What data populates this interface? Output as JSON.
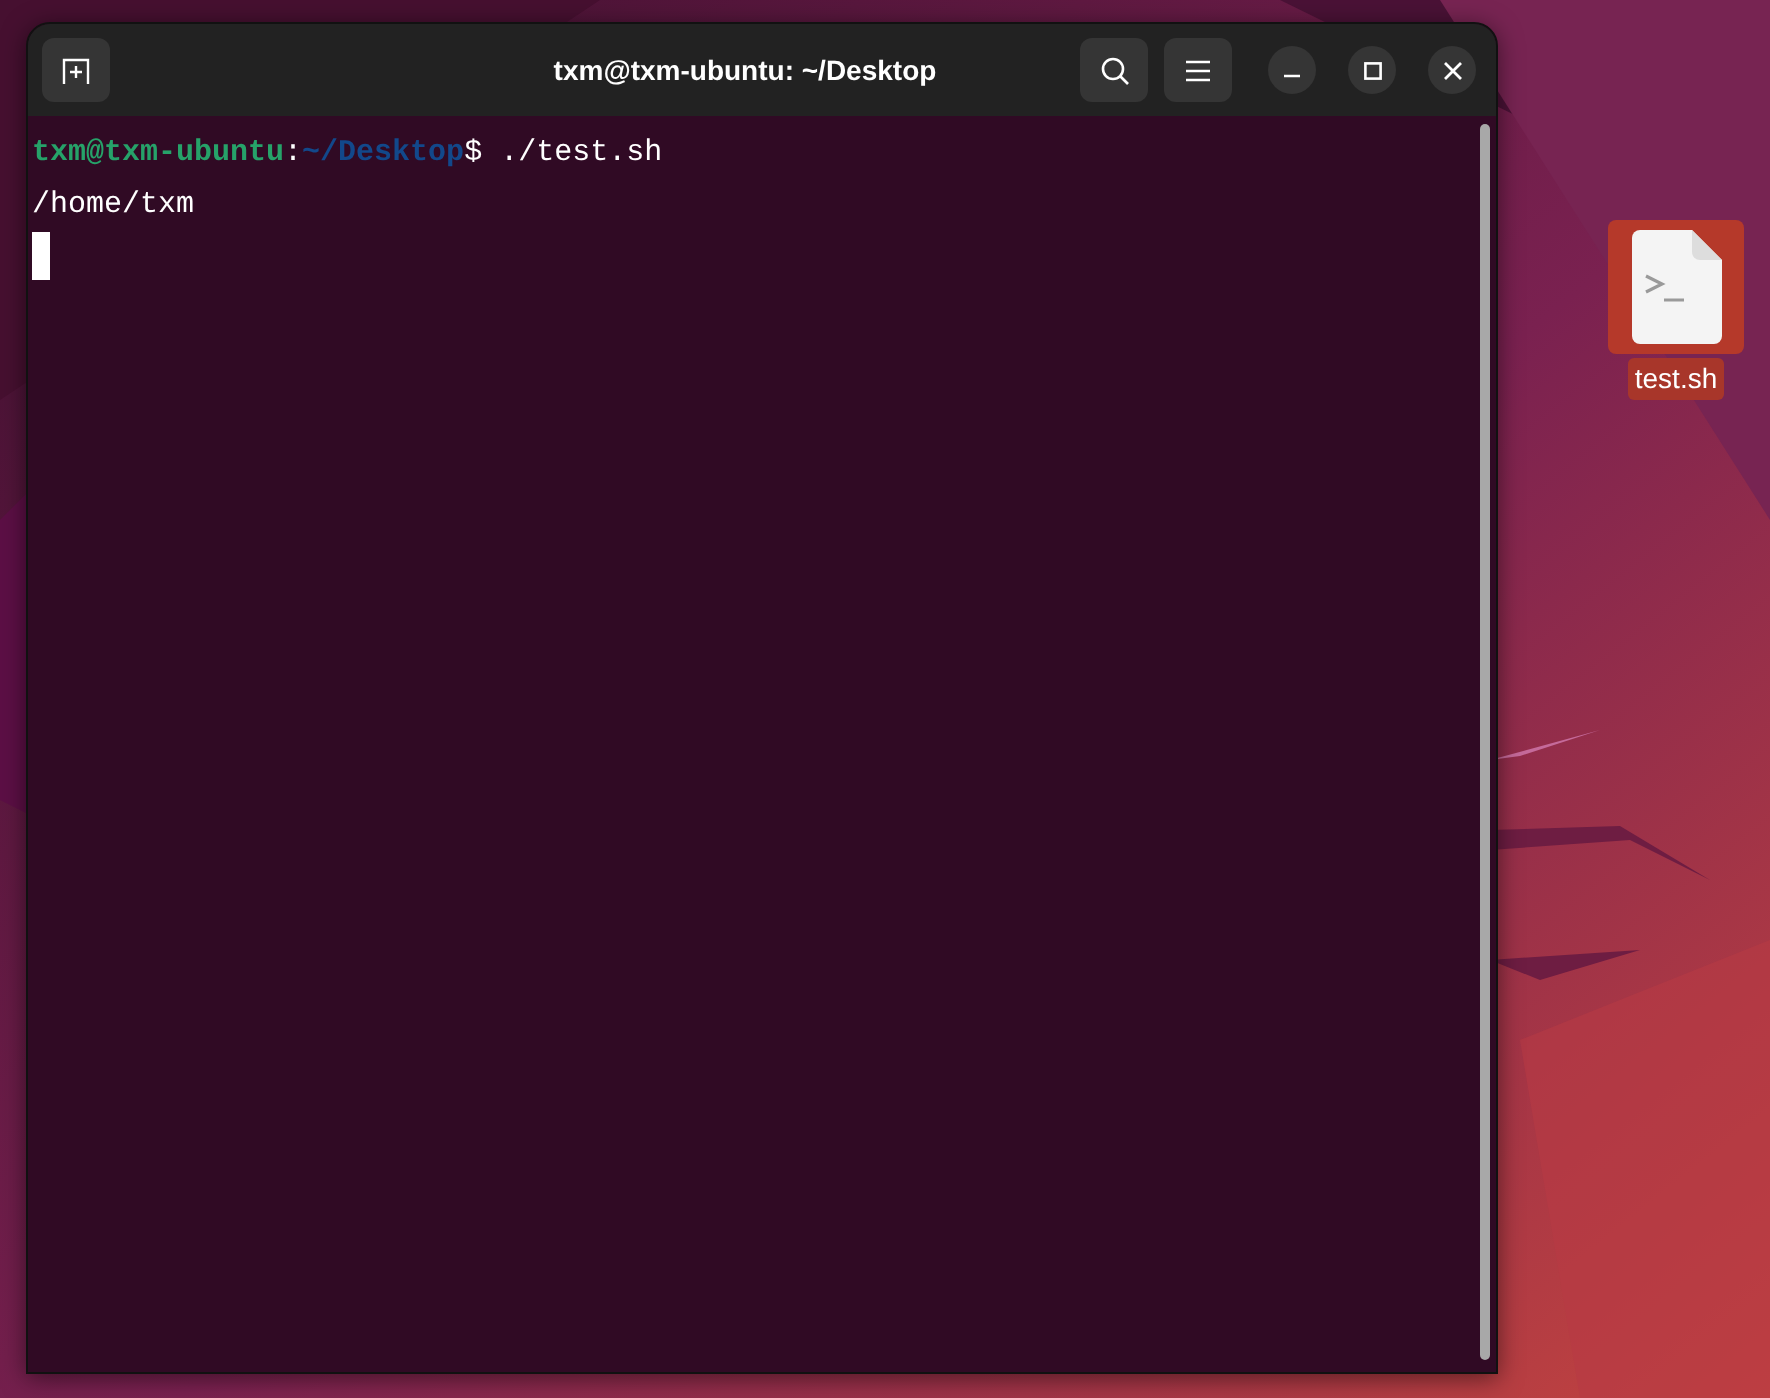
{
  "window": {
    "title": "txm@txm-ubuntu: ~/Desktop"
  },
  "terminal": {
    "lines": [
      {
        "segments": [
          {
            "kind": "user",
            "text": "txm@txm-ubuntu"
          },
          {
            "kind": "plain",
            "text": ":"
          },
          {
            "kind": "path",
            "text": "~/Desktop"
          },
          {
            "kind": "plain",
            "text": "$ ./test.sh"
          }
        ]
      },
      {
        "segments": [
          {
            "kind": "plain",
            "text": "/home/txm"
          }
        ]
      }
    ],
    "cursor": true
  },
  "desktop_icons": [
    {
      "label": "test.sh",
      "selected": true
    }
  ]
}
